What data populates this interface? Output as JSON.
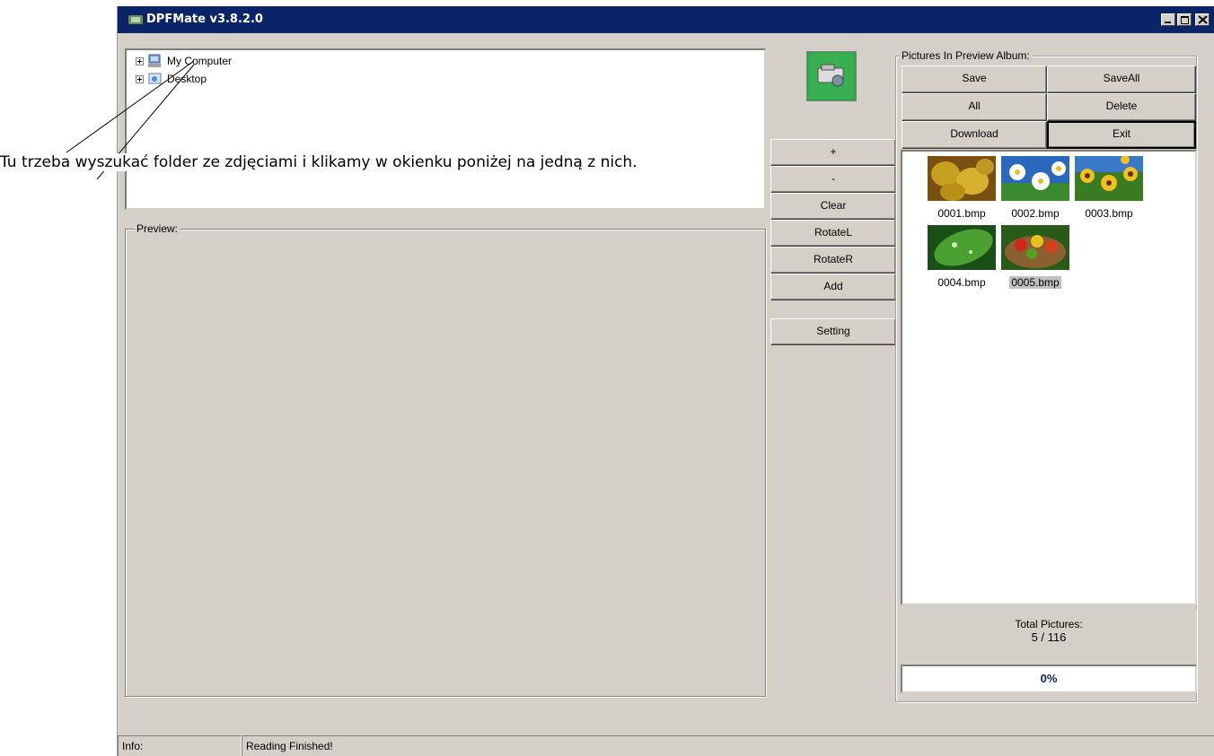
{
  "window": {
    "title": "DPFMate v3.8.2.0"
  },
  "tree": {
    "items": [
      {
        "label": "My Computer",
        "icon": "my-computer-icon"
      },
      {
        "label": "Desktop",
        "icon": "desktop-icon"
      }
    ]
  },
  "preview": {
    "label": "Preview:"
  },
  "middle_buttons": {
    "plus": "+",
    "minus": "-",
    "clear": "Clear",
    "rotate_left": "RotateL",
    "rotate_right": "RotateR",
    "add": "Add",
    "setting": "Setting"
  },
  "album": {
    "label": "Pictures In Preview Album:",
    "buttons": {
      "save": "Save",
      "save_all": "SaveAll",
      "all": "All",
      "delete": "Delete",
      "download": "Download",
      "exit": "Exit"
    },
    "thumbnails": [
      {
        "name": "0001.bmp",
        "icon": "pears-image",
        "selected": false
      },
      {
        "name": "0002.bmp",
        "icon": "daisies-image",
        "selected": false
      },
      {
        "name": "0003.bmp",
        "icon": "sunflowers-image",
        "selected": false
      },
      {
        "name": "0004.bmp",
        "icon": "leaf-image",
        "selected": false
      },
      {
        "name": "0005.bmp",
        "icon": "vegetables-image",
        "selected": true
      }
    ],
    "total_label": "Total Pictures:",
    "total_value": "5 / 116",
    "progress": "0%"
  },
  "status": {
    "info_label": "Info:",
    "message": "Reading Finished!"
  },
  "annotation": {
    "text": "Tu trzeba wyszukać folder ze zdjęciami i klikamy w okienku poniżej na jedną z nich."
  },
  "colors": {
    "titlebar": "#0a246a",
    "face": "#d4d0c8"
  }
}
